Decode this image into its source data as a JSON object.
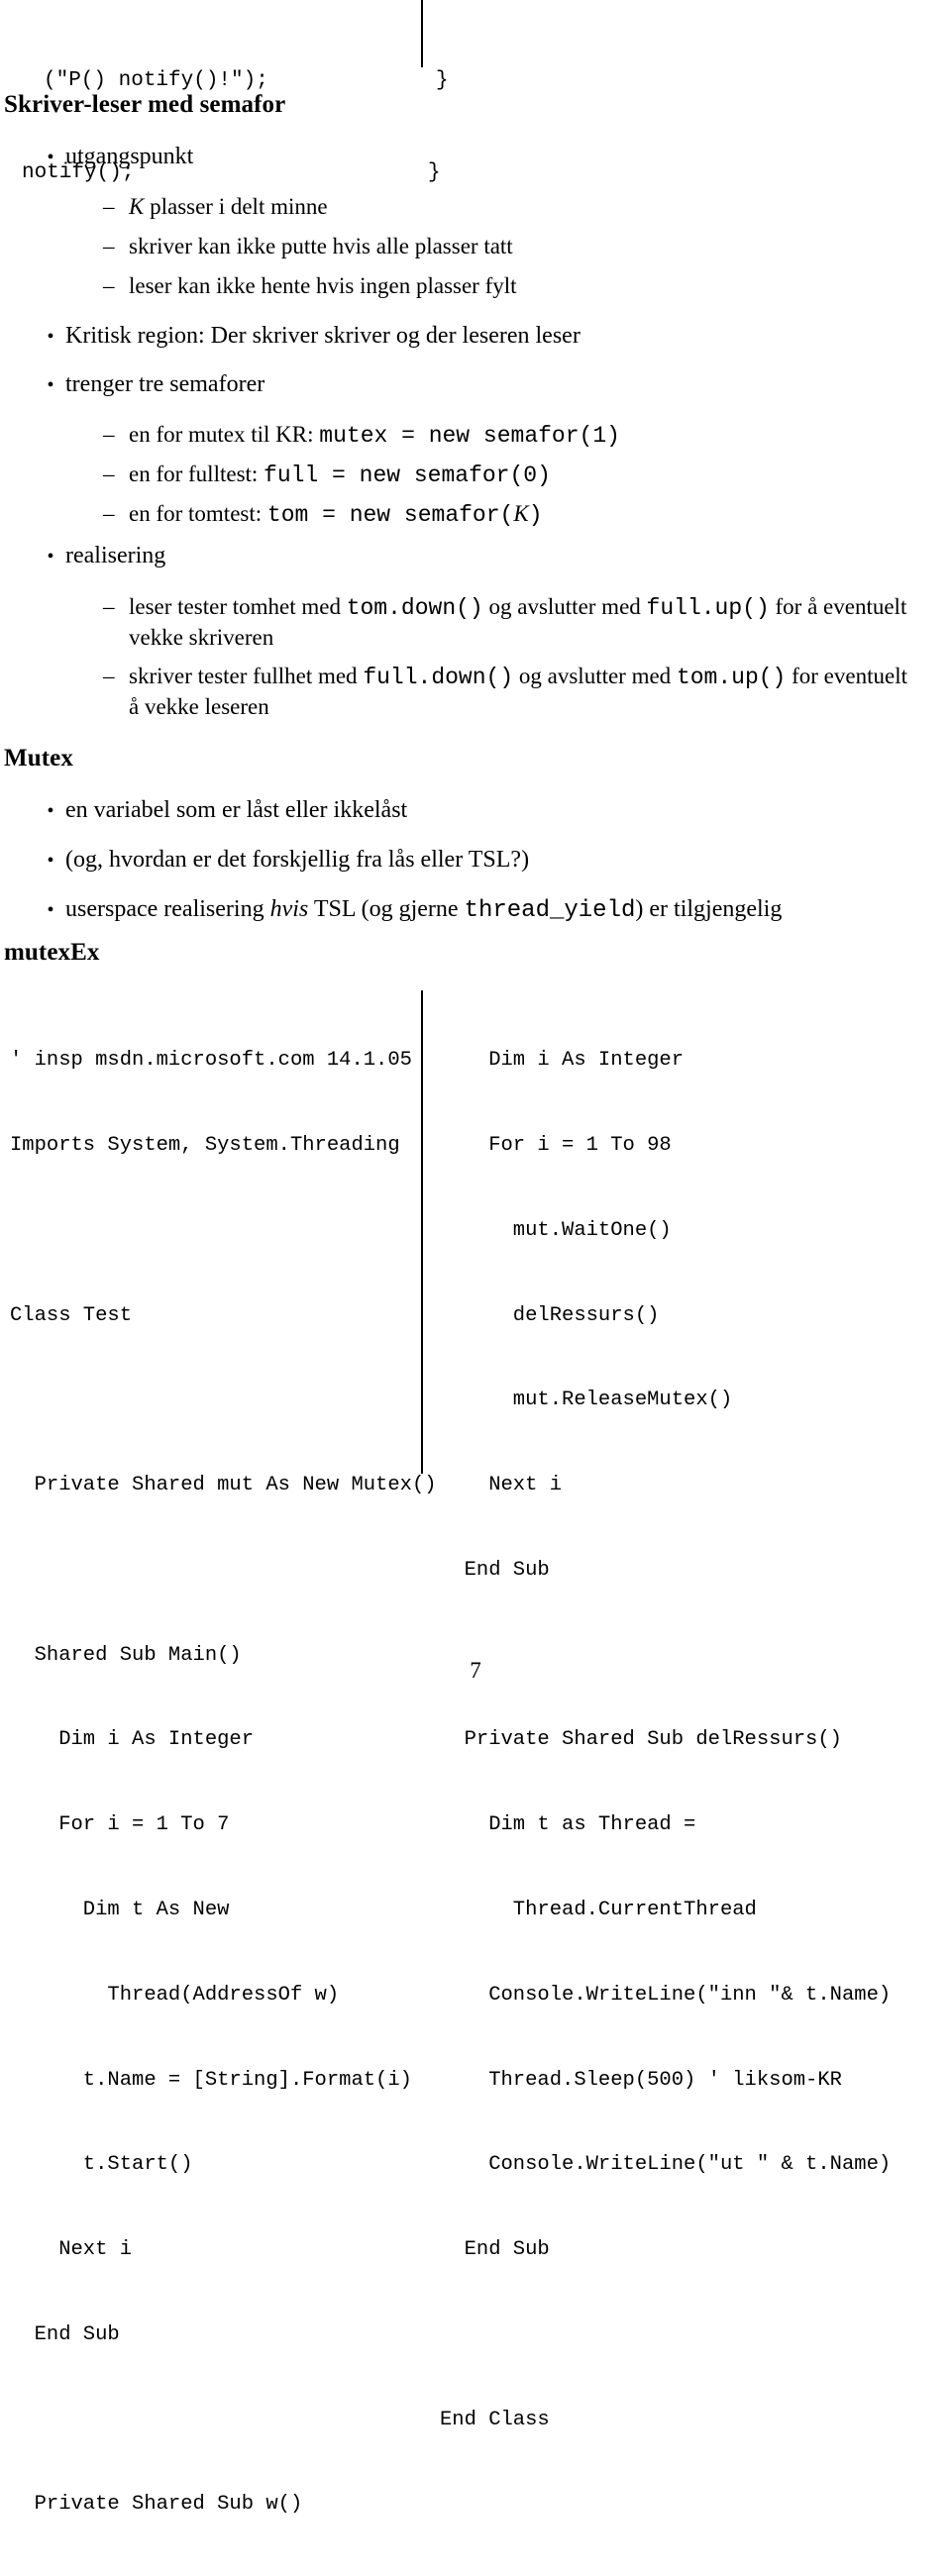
{
  "top_code": {
    "left_lines": [
      "(\"P() notify()!\");",
      "notify();"
    ],
    "right_lines": [
      "}",
      "}"
    ]
  },
  "sections": [
    {
      "id": "skriver-leser",
      "heading": "Skriver-leser med semafor",
      "items": [
        {
          "level": 1,
          "marker": "•",
          "text": "utgangspunkt"
        },
        {
          "level": 2,
          "marker": "–",
          "runs": [
            {
              "style": "mathit",
              "text": "K"
            },
            {
              "style": "roman",
              "text": " plasser i delt minne"
            }
          ]
        },
        {
          "level": 2,
          "marker": "–",
          "runs": [
            {
              "style": "roman",
              "text": "skriver kan ikke putte hvis alle plasser tatt"
            }
          ]
        },
        {
          "level": 2,
          "marker": "–",
          "runs": [
            {
              "style": "roman",
              "text": "leser kan ikke hente hvis ingen plasser fylt"
            }
          ]
        },
        {
          "level": 1,
          "marker": "•",
          "text": "Kritisk region: Der skriver skriver og der leseren leser"
        },
        {
          "level": 1,
          "marker": "•",
          "text": "trenger tre semaforer"
        },
        {
          "level": 2,
          "marker": "–",
          "runs": [
            {
              "style": "roman",
              "text": "en for mutex til KR: "
            },
            {
              "style": "mono",
              "text": "mutex = new semafor(1)"
            }
          ]
        },
        {
          "level": 2,
          "marker": "–",
          "runs": [
            {
              "style": "roman",
              "text": "en for fulltest: "
            },
            {
              "style": "mono",
              "text": "full = new semafor(0)"
            }
          ]
        },
        {
          "level": 2,
          "marker": "–",
          "runs": [
            {
              "style": "roman",
              "text": "en for tomtest: "
            },
            {
              "style": "mono",
              "text": "tom = new semafor("
            },
            {
              "style": "mathit",
              "text": "K"
            },
            {
              "style": "mono",
              "text": ")"
            }
          ]
        },
        {
          "level": 1,
          "marker": "•",
          "text": "realisering"
        },
        {
          "level": 2,
          "marker": "–",
          "runs": [
            {
              "style": "roman",
              "text": "leser tester tomhet med "
            },
            {
              "style": "mono",
              "text": "tom.down()"
            },
            {
              "style": "roman",
              "text": " og avslutter med "
            },
            {
              "style": "mono",
              "text": "full.up()"
            },
            {
              "style": "roman",
              "text": " for å eventuelt vekke skriveren"
            }
          ]
        },
        {
          "level": 2,
          "marker": "–",
          "runs": [
            {
              "style": "roman",
              "text": "skriver tester fullhet med "
            },
            {
              "style": "mono",
              "text": "full.down()"
            },
            {
              "style": "roman",
              "text": " og avslutter med "
            },
            {
              "style": "mono",
              "text": "tom.up()"
            },
            {
              "style": "roman",
              "text": " for eventuelt å vekke leseren"
            }
          ]
        }
      ]
    },
    {
      "id": "mutex",
      "heading": "Mutex",
      "items": [
        {
          "level": 1,
          "marker": "•",
          "text": "en variabel som er låst eller ikkelåst"
        },
        {
          "level": 1,
          "marker": "•",
          "text": "(og, hvordan er det forskjellig fra lås eller TSL?)"
        },
        {
          "level": 1,
          "marker": "•",
          "runs": [
            {
              "style": "roman",
              "text": "userspace realisering "
            },
            {
              "style": "italic",
              "text": "hvis"
            },
            {
              "style": "roman",
              "text": " TSL (og gjerne "
            },
            {
              "style": "mono",
              "text": "thread_yield"
            },
            {
              "style": "roman",
              "text": ") er tilgjengelig"
            }
          ]
        }
      ]
    },
    {
      "id": "mutexex",
      "heading": "mutexEx",
      "items": []
    }
  ],
  "listing": {
    "left_lines": [
      "' insp msdn.microsoft.com 14.1.05",
      "Imports System, System.Threading",
      "",
      "Class Test",
      "",
      "  Private Shared mut As New Mutex()",
      "",
      "  Shared Sub Main()",
      "    Dim i As Integer",
      "    For i = 1 To 7",
      "      Dim t As New",
      "        Thread(AddressOf w)",
      "      t.Name = [String].Format(i)",
      "      t.Start()",
      "    Next i",
      "  End Sub",
      "",
      "  Private Shared Sub w()"
    ],
    "right_lines": [
      "    Dim i As Integer",
      "    For i = 1 To 98",
      "      mut.WaitOne()",
      "      delRessurs()",
      "      mut.ReleaseMutex()",
      "    Next i",
      "  End Sub",
      "",
      "  Private Shared Sub delRessurs()",
      "    Dim t as Thread =",
      "      Thread.CurrentThread",
      "    Console.WriteLine(\"inn \"& t.Name)",
      "    Thread.Sleep(500) ' liksom-KR",
      "    Console.WriteLine(\"ut \" & t.Name)",
      "  End Sub",
      "",
      "End Class"
    ]
  },
  "footer": {
    "page_number": "7"
  }
}
